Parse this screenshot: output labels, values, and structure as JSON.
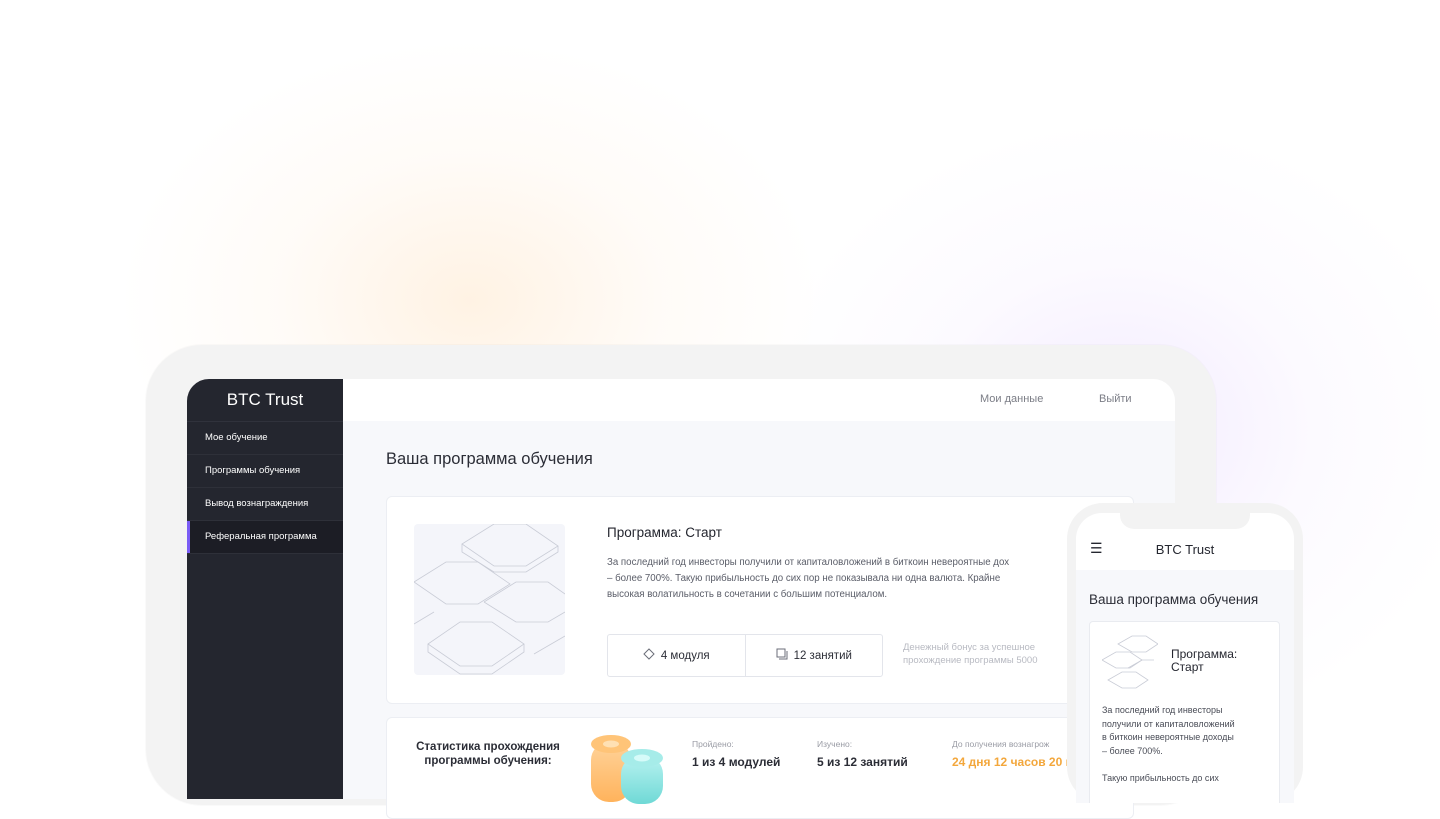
{
  "app": {
    "brand": "BTC Trust"
  },
  "sidebar": {
    "items": [
      {
        "label": "Мое обучение"
      },
      {
        "label": "Программы обучения"
      },
      {
        "label": "Вывод вознаграждения"
      },
      {
        "label": "Реферальная программа"
      }
    ]
  },
  "topbar": {
    "my_data": "Мои данные",
    "logout": "Выйти"
  },
  "main": {
    "title": "Ваша программа обучения",
    "program": {
      "title": "Программа: Старт",
      "description": "За последний год инвесторы получили от капиталовложений в биткоин невероятные дох\n– более 700%. Такую прибыльность до сих пор не показывала ни одна валюта. Крайне\nвысокая волатильность в сочетании с большим потенциалом.",
      "modules": "4 модуля",
      "lessons": "12 занятий",
      "bonus": "Денежный бонус за успешное\nпрохождение программы 5000"
    },
    "stats": {
      "title": "Статистика прохождения\nпрограммы обучения:",
      "passed_label": "Пройдено:",
      "passed_value": "1 из 4 модулей",
      "studied_label": "Изучено:",
      "studied_value": "5 из 12 занятий",
      "reward_label": "До получения вознагрож",
      "reward_value": "24 дня 12 часов 20 м"
    }
  },
  "mobile": {
    "brand": "BTC Trust",
    "title": "Ваша программа обучения",
    "program_title": "Программа:\nСтарт",
    "text1": "За последний год инвесторы\nполучили от капиталовложений\nв биткоин невероятные доходы\n– более 700%.",
    "text2": "Такую прибыльность до сих"
  },
  "colors": {
    "accent": "#7a5cf5",
    "sidebar": "#24262f",
    "highlight": "#f3a73c"
  },
  "icons": {
    "modules": "diamond-icon",
    "lessons": "copy-icon",
    "menu": "hamburger-icon"
  }
}
